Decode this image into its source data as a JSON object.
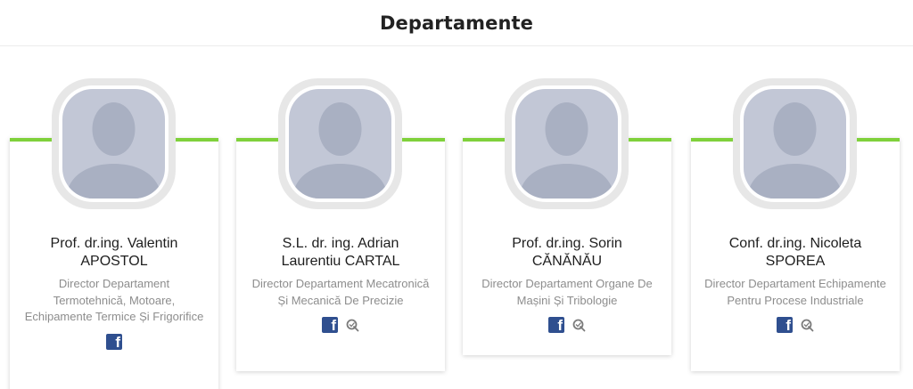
{
  "header": {
    "title": "Departamente"
  },
  "colors": {
    "accent": "#7fd13b",
    "facebook": "#2f4f8f",
    "avatar": "#c2c7d6"
  },
  "cards": [
    {
      "name": "Prof. dr.ing. Valentin APOSTOL",
      "role": "Director Departament Termotehnică, Motoare, Echipamente Termice Și Frigorifice",
      "icons": [
        "facebook-icon"
      ]
    },
    {
      "name": "S.L. dr. ing. Adrian Laurentiu CARTAL",
      "role": "Director Departament Mecatronică Și Mecanică De Precizie",
      "icons": [
        "facebook-icon",
        "researchgate-icon"
      ]
    },
    {
      "name": "Prof. dr.ing. Sorin CĂNĂNĂU",
      "role": "Director Departament Organe De Mașini Și Tribologie",
      "icons": [
        "facebook-icon",
        "researchgate-icon"
      ]
    },
    {
      "name": "Conf. dr.ing. Nicoleta SPOREA",
      "role": "Director Departament Echipamente Pentru Procese Industriale",
      "icons": [
        "facebook-icon",
        "researchgate-icon"
      ]
    }
  ]
}
